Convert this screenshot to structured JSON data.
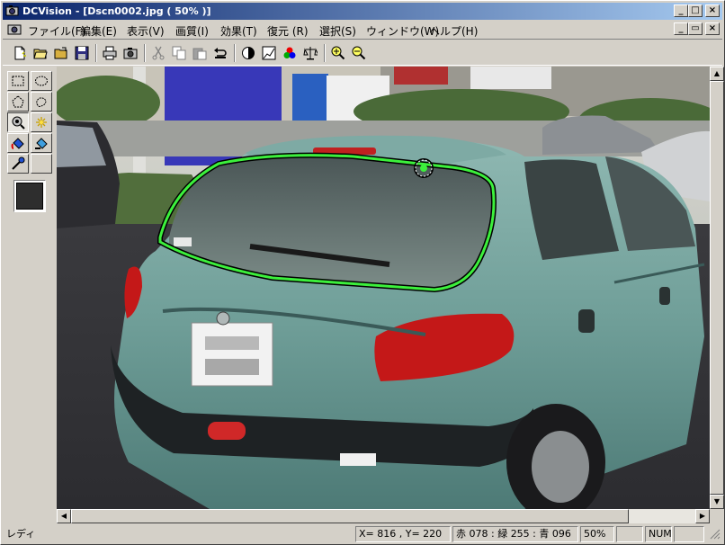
{
  "window": {
    "title": "DCVision - [Dscn0002.jpg ( 50% )]",
    "minimize_glyph": "_",
    "maximize_glyph": "□",
    "close_glyph": "×"
  },
  "menu": {
    "items": [
      "ファイル(F)",
      "編集(E)",
      "表示(V)",
      "画質(I)",
      "効果(T)",
      "復元 (R)",
      "選択(S)",
      "ウィンドウ(W)",
      "ヘルプ(H)"
    ],
    "mdi_minimize": "_",
    "mdi_restore": "▭",
    "mdi_close": "×"
  },
  "toolbar": {
    "icons": [
      "new-icon",
      "open-folder-icon",
      "open-icon",
      "save-icon",
      "print-icon",
      "camera-icon",
      "cut-icon",
      "copy-icon",
      "paste-icon",
      "undo-icon",
      "contrast-icon",
      "histogram-icon",
      "color-balance-icon",
      "level-icon",
      "zoom-in-icon",
      "zoom-out-icon"
    ]
  },
  "palette": {
    "icons": [
      "rect-select-icon",
      "ellipse-select-icon",
      "polygon-select-icon",
      "lasso-select-icon",
      "magic-wand-icon",
      "color-range-icon",
      "fill-icon",
      "gradient-fill-icon",
      "eyedropper-icon"
    ],
    "current_color": "#2e2e2e"
  },
  "status": {
    "ready": "レディ",
    "coords": "X= 816 , Y= 220",
    "rgb": "赤 078 : 緑 255 : 青 096",
    "zoom": "50%",
    "num": "NUM"
  },
  "colors": {
    "selection": "#3cf03c",
    "car_body": "#6f9e98",
    "titlebar_start": "#0a246a"
  }
}
